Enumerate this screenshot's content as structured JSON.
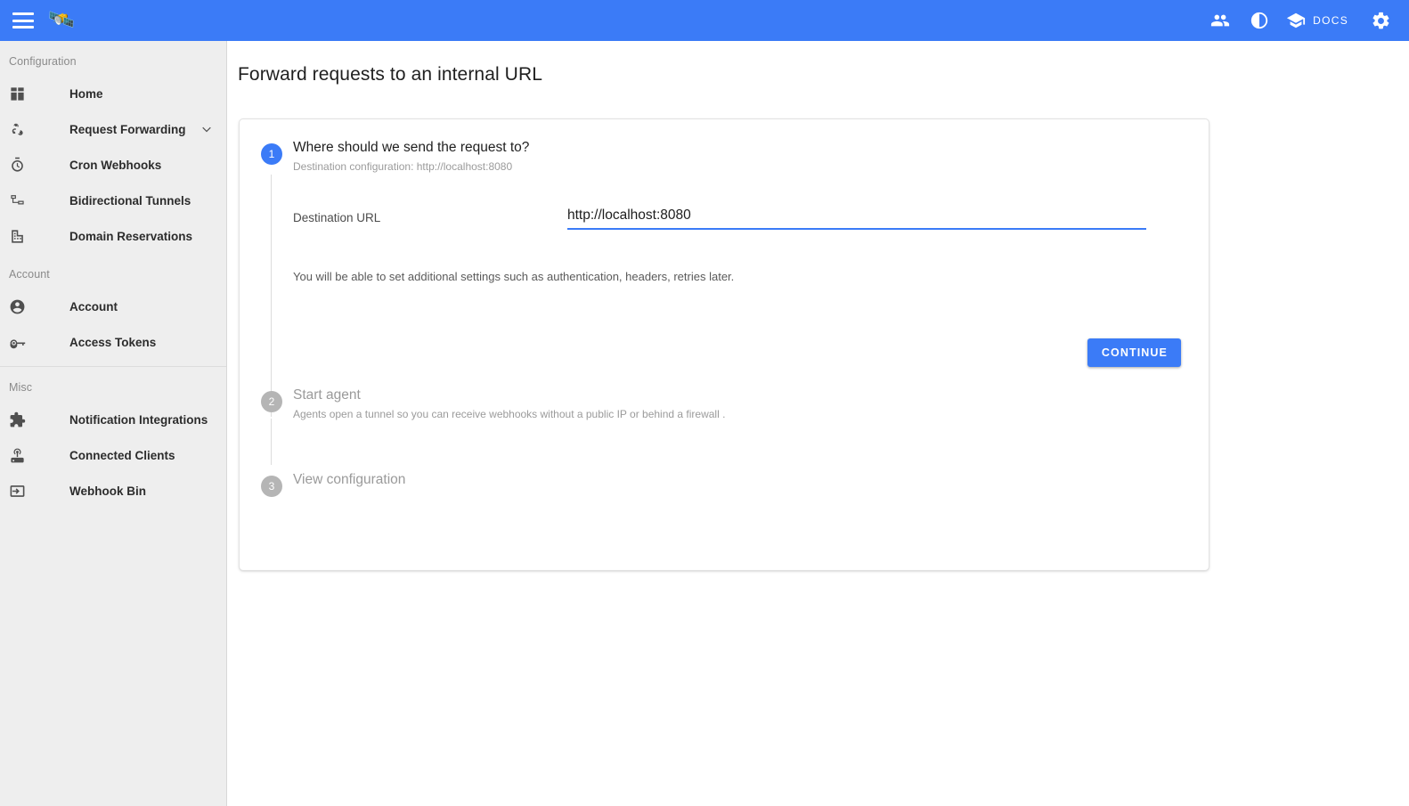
{
  "appbar": {
    "menu_icon": "hamburger-menu-icon",
    "logo": "🛰️",
    "actions": [
      {
        "name": "people-icon",
        "label": ""
      },
      {
        "name": "brightness-contrast-icon",
        "label": ""
      },
      {
        "name": "school-icon",
        "label": "DOCS"
      },
      {
        "name": "gear-icon",
        "label": ""
      }
    ],
    "docs_label": "DOCS"
  },
  "sidebar": {
    "sections": [
      {
        "label": "Configuration",
        "items": [
          {
            "label": "Home",
            "icon": "dashboard-icon",
            "expandable": false
          },
          {
            "label": "Request Forwarding",
            "icon": "webhook-icon",
            "expandable": true
          },
          {
            "label": "Cron Webhooks",
            "icon": "timer-icon",
            "expandable": false
          },
          {
            "label": "Bidirectional Tunnels",
            "icon": "device-hub-icon",
            "expandable": false
          },
          {
            "label": "Domain Reservations",
            "icon": "domain-icon",
            "expandable": false
          }
        ]
      },
      {
        "label": "Account",
        "items": [
          {
            "label": "Account",
            "icon": "account-circle-icon",
            "expandable": false
          },
          {
            "label": "Access Tokens",
            "icon": "key-icon",
            "expandable": false
          }
        ]
      },
      {
        "label": "Misc",
        "items": [
          {
            "label": "Notification Integrations",
            "icon": "puzzle-piece-icon",
            "expandable": false
          },
          {
            "label": "Connected Clients",
            "icon": "router-icon",
            "expandable": false
          },
          {
            "label": "Webhook Bin",
            "icon": "input-arrow-icon",
            "expandable": false
          }
        ]
      }
    ]
  },
  "main": {
    "page_title": "Forward requests to an internal URL",
    "steps": [
      {
        "number": "1",
        "title": "Where should we send the request to?",
        "subtitle": "Destination configuration: http://localhost:8080",
        "state": "active"
      },
      {
        "number": "2",
        "title": "Start agent",
        "subtitle": "Agents open a tunnel so you can receive webhooks without a public IP or behind a firewall .",
        "state": "inactive"
      },
      {
        "number": "3",
        "title": "View configuration",
        "subtitle": "",
        "state": "inactive"
      }
    ],
    "form": {
      "destination_label": "Destination URL",
      "destination_value": "http://localhost:8080",
      "destination_placeholder": "http://localhost:8080",
      "helper_text": "You will be able to set additional settings such as authentication, headers, retries later.",
      "continue_label": "CONTINUE"
    }
  },
  "colors": {
    "accent": "#3b7bf7",
    "sidebar_bg": "#eeeeee",
    "page_bg": "#ffffff",
    "muted_text": "#9b9b9b",
    "inactive_badge": "#b5b5b5"
  }
}
